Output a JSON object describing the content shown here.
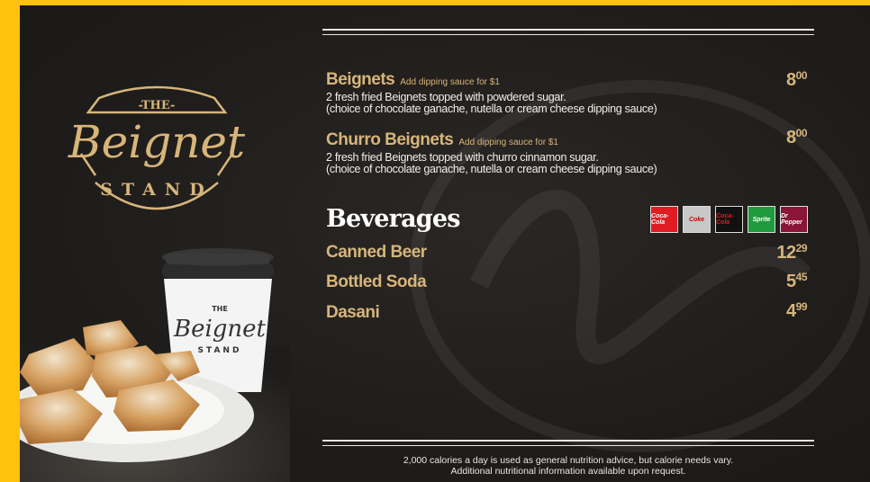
{
  "logo": {
    "line_top": "-THE-",
    "line_main": "Beignet",
    "line_bottom": "STAND"
  },
  "cup_logo": {
    "line_top": "THE",
    "line_main": "Beignet",
    "line_bottom": "STAND"
  },
  "menu": {
    "items": [
      {
        "name": "Beignets",
        "note": "Add dipping sauce for $1",
        "desc1": "2 fresh fried Beignets topped with powdered sugar.",
        "desc2": "(choice of chocolate ganache, nutella or cream cheese dipping sauce)",
        "price_whole": "8",
        "price_cents": "00"
      },
      {
        "name": "Churro Beignets",
        "note": "Add dipping sauce for $1",
        "desc1": "2 fresh fried Beignets topped with churro cinnamon sugar.",
        "desc2": "(choice of chocolate ganache, nutella or cream cheese dipping sauce)",
        "price_whole": "8",
        "price_cents": "00"
      }
    ]
  },
  "beverages": {
    "title": "Beverages",
    "brands": [
      {
        "name": "Coca-Cola",
        "color": "#e11b22"
      },
      {
        "name": "Coke",
        "color": "#c8c8c8"
      },
      {
        "name": "Coca-Cola",
        "color": "#111111"
      },
      {
        "name": "Sprite",
        "color": "#1f9a3c"
      },
      {
        "name": "Dr Pepper",
        "color": "#8a1538"
      }
    ],
    "items": [
      {
        "name": "Canned Beer",
        "price_whole": "12",
        "price_cents": "29"
      },
      {
        "name": "Bottled Soda",
        "price_whole": "5",
        "price_cents": "45"
      },
      {
        "name": "Dasani",
        "price_whole": "4",
        "price_cents": "99"
      }
    ]
  },
  "footer": {
    "line1": "2,000 calories a day is used as general nutrition advice, but calorie needs vary.",
    "line2": "Additional nutritional information available upon request."
  },
  "colors": {
    "accent_gold": "#d7b57a",
    "background": "#1f1d1b",
    "frame": "#ffc20e"
  }
}
